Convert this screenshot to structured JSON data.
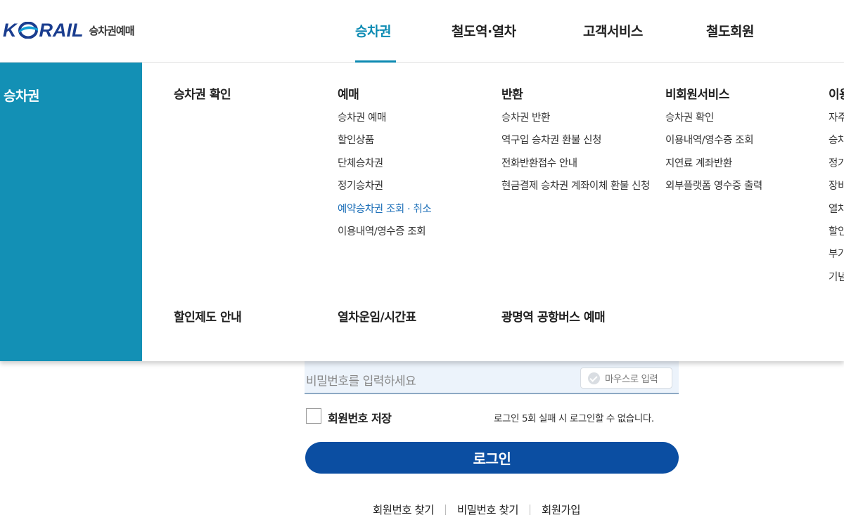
{
  "brand": {
    "logo_text_pre": "K",
    "logo_text_post": "RAIL",
    "sub": "승차권예매",
    "brand_color": "#1a3d8f"
  },
  "gnb": [
    {
      "label": "승차권",
      "active": true
    },
    {
      "label": "철도역·열차"
    },
    {
      "label": "고객서비스"
    },
    {
      "label": "철도회원"
    }
  ],
  "mega": {
    "side_title": "승차권",
    "accent_color": "#1390b5",
    "columns": [
      {
        "title": "승차권 확인",
        "items": []
      },
      {
        "title": "예매",
        "items": [
          "승차권 예매",
          "할인상품",
          "단체승차권",
          "정기승차권",
          "예약승차권 조회 · 취소",
          "이용내역/영수증 조회"
        ],
        "highlight_index": 4
      },
      {
        "title": "반환",
        "items": [
          "승차권 반환",
          "역구입 승차권 환불 신청",
          "전화반환접수 안내",
          "현금결제 승차권 계좌이체 환불 신청"
        ]
      },
      {
        "title": "비회원서비스",
        "items": [
          "승차권 확인",
          "이용내역/영수증 조회",
          "지연료 계좌반환",
          "외부플랫폼 영수증 출력"
        ]
      },
      {
        "title": "이용",
        "items": [
          "자주",
          "승차",
          "정기",
          "장비",
          "열차",
          "할인",
          "부가",
          "기념"
        ]
      }
    ],
    "row2": [
      "할인제도 안내",
      "열차운임/시간표",
      "광명역 공항버스 예매"
    ]
  },
  "login": {
    "password_placeholder": "비밀번호를 입력하세요",
    "mouse_input_label": "마우스로 입력",
    "save_label": "회원번호 저장",
    "fail_notice": "로그인 5회 실패 시 로그인할 수 없습니다.",
    "login_button": "로그인",
    "login_color": "#0b4ea2",
    "links": [
      "회원번호 찾기",
      "비밀번호 찾기",
      "회원가입"
    ]
  }
}
